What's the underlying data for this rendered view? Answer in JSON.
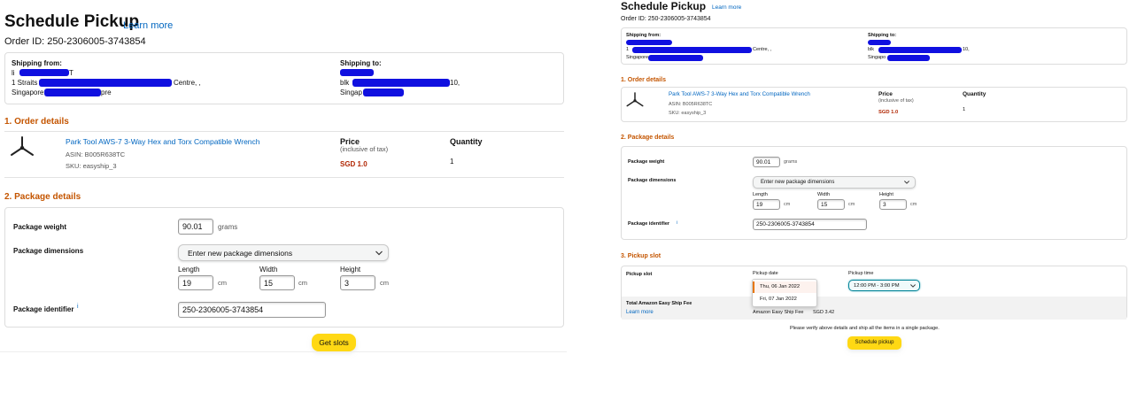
{
  "left": {
    "header": {
      "title": "Schedule Pickup",
      "learn_more": "Learn more",
      "order_id": "Order ID: 250-2306005-3743854"
    },
    "shipping": {
      "from_label": "Shipping from:",
      "from_line1": "li",
      "from_line1_suffix": "T",
      "from_line2_prefix": "1 Straits",
      "from_line2_suffix": "Centre, ,",
      "from_line3_prefix": "Singapore",
      "from_line3_suffix": "pre",
      "to_label": "Shipping to:",
      "to_line2_prefix": "blk",
      "to_line2_suffix": "10,",
      "to_line3_prefix": "Singap"
    },
    "order_details": {
      "heading": "1. Order details",
      "product_name": "Park Tool AWS-7 3-Way Hex and Torx Compatible Wrench",
      "asin": "ASIN: B005R638TC",
      "sku": "SKU: easyship_3",
      "price_label": "Price",
      "price_note": "(inclusive of tax)",
      "price_value": "SGD 1.0",
      "quantity_label": "Quantity",
      "quantity_value": "1"
    },
    "package_details": {
      "heading": "2. Package details",
      "weight_label": "Package weight",
      "weight_value": "90.01",
      "weight_unit": "grams",
      "dimensions_label": "Package dimensions",
      "dimensions_option": "Enter new package dimensions",
      "length_label": "Length",
      "length_value": "19",
      "width_label": "Width",
      "width_value": "15",
      "height_label": "Height",
      "height_value": "3",
      "unit_cm": "cm",
      "identifier_label": "Package identifier",
      "identifier_info": "i",
      "identifier_value": "250-2306005-3743854"
    },
    "get_slots_label": "Get slots"
  },
  "right": {
    "header": {
      "title": "Schedule Pickup",
      "learn_more": "Learn more",
      "order_id": "Order ID: 250-2306005-3743854"
    },
    "shipping": {
      "from_label": "Shipping from:",
      "from_line2_prefix": "1",
      "from_line2_suffix": "Centre, ,",
      "from_line3_prefix": "Singapore",
      "to_label": "Shipping to:",
      "to_line2_prefix": "blk",
      "to_line2_suffix": "10,",
      "to_line3_prefix": "Singapo"
    },
    "order_details": {
      "heading": "1. Order details",
      "product_name": "Park Tool AWS-7 3-Way Hex and Torx Compatible Wrench",
      "asin": "ASIN: B005R638TC",
      "sku": "SKU: easyship_3",
      "price_label": "Price",
      "price_note": "(inclusive of tax)",
      "price_value": "SGD 1.0",
      "quantity_label": "Quantity",
      "quantity_value": "1"
    },
    "package_details": {
      "heading": "2. Package details",
      "weight_label": "Package weight",
      "weight_value": "90.01",
      "weight_unit": "grams",
      "dimensions_label": "Package dimensions",
      "dimensions_option": "Enter new package dimensions",
      "length_label": "Length",
      "length_value": "19",
      "width_label": "Width",
      "width_value": "15",
      "height_label": "Height",
      "height_value": "3",
      "unit_cm": "cm",
      "identifier_label": "Package identifier",
      "identifier_info": "i",
      "identifier_value": "250-2306005-3743854"
    },
    "pickup_slot": {
      "heading": "3. Pickup slot",
      "slot_label": "Pickup slot",
      "date_label": "Pickup date",
      "date_options": [
        "Thu, 06 Jan 2022",
        "Fri, 07 Jan 2022"
      ],
      "time_label": "Pickup time",
      "time_value": "12:00 PM - 3:00 PM",
      "fee_label": "Total Amazon Easy Ship Fee",
      "fee_learn_more": "Learn more",
      "fee_text": "Amazon Easy Ship Fee",
      "fee_value": "SGD 3.42",
      "verify_note": "Please verify above details and ship all the items in a single package.",
      "schedule_label": "Schedule pickup"
    }
  },
  "colors": {
    "accent": "#c45500",
    "link": "#0066c0",
    "button": "#ffd814",
    "price": "#b12704",
    "redaction": "#1010e0"
  }
}
